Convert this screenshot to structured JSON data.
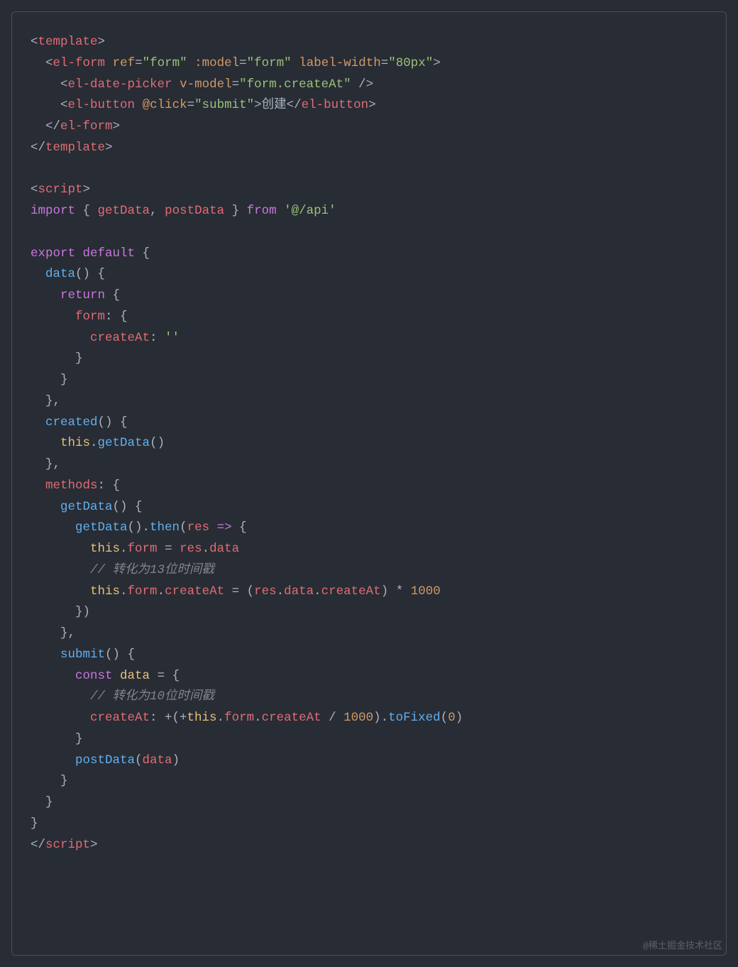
{
  "code": {
    "lines": [
      {
        "tokens": [
          {
            "t": "<",
            "c": "angle"
          },
          {
            "t": "template",
            "c": "tag"
          },
          {
            "t": ">",
            "c": "angle"
          }
        ]
      },
      {
        "tokens": [
          {
            "t": "  ",
            "c": "punct"
          },
          {
            "t": "<",
            "c": "angle"
          },
          {
            "t": "el-form",
            "c": "tag"
          },
          {
            "t": " ",
            "c": "punct"
          },
          {
            "t": "ref",
            "c": "attr"
          },
          {
            "t": "=",
            "c": "punct"
          },
          {
            "t": "\"form\"",
            "c": "attrv"
          },
          {
            "t": " ",
            "c": "punct"
          },
          {
            "t": ":model",
            "c": "attr"
          },
          {
            "t": "=",
            "c": "punct"
          },
          {
            "t": "\"form\"",
            "c": "attrv"
          },
          {
            "t": " ",
            "c": "punct"
          },
          {
            "t": "label-width",
            "c": "attr"
          },
          {
            "t": "=",
            "c": "punct"
          },
          {
            "t": "\"80px\"",
            "c": "attrv"
          },
          {
            "t": ">",
            "c": "angle"
          }
        ]
      },
      {
        "tokens": [
          {
            "t": "    ",
            "c": "punct"
          },
          {
            "t": "<",
            "c": "angle"
          },
          {
            "t": "el-date-picker",
            "c": "tag"
          },
          {
            "t": " ",
            "c": "punct"
          },
          {
            "t": "v-model",
            "c": "attr"
          },
          {
            "t": "=",
            "c": "punct"
          },
          {
            "t": "\"form.createAt\"",
            "c": "attrv"
          },
          {
            "t": " />",
            "c": "angle"
          }
        ]
      },
      {
        "tokens": [
          {
            "t": "    ",
            "c": "punct"
          },
          {
            "t": "<",
            "c": "angle"
          },
          {
            "t": "el-button",
            "c": "tag"
          },
          {
            "t": " ",
            "c": "punct"
          },
          {
            "t": "@click",
            "c": "attr"
          },
          {
            "t": "=",
            "c": "punct"
          },
          {
            "t": "\"submit\"",
            "c": "attrv"
          },
          {
            "t": ">",
            "c": "angle"
          },
          {
            "t": "创建",
            "c": "text"
          },
          {
            "t": "</",
            "c": "angle"
          },
          {
            "t": "el-button",
            "c": "tag"
          },
          {
            "t": ">",
            "c": "angle"
          }
        ]
      },
      {
        "tokens": [
          {
            "t": "  ",
            "c": "punct"
          },
          {
            "t": "</",
            "c": "angle"
          },
          {
            "t": "el-form",
            "c": "tag"
          },
          {
            "t": ">",
            "c": "angle"
          }
        ]
      },
      {
        "tokens": [
          {
            "t": "</",
            "c": "angle"
          },
          {
            "t": "template",
            "c": "tag"
          },
          {
            "t": ">",
            "c": "angle"
          }
        ]
      },
      {
        "tokens": [
          {
            "t": "",
            "c": "punct"
          }
        ]
      },
      {
        "tokens": [
          {
            "t": "<",
            "c": "angle"
          },
          {
            "t": "script",
            "c": "tag"
          },
          {
            "t": ">",
            "c": "angle"
          }
        ]
      },
      {
        "tokens": [
          {
            "t": "import",
            "c": "kw"
          },
          {
            "t": " { ",
            "c": "punct"
          },
          {
            "t": "getData",
            "c": "ident"
          },
          {
            "t": ", ",
            "c": "punct"
          },
          {
            "t": "postData",
            "c": "ident"
          },
          {
            "t": " } ",
            "c": "punct"
          },
          {
            "t": "from",
            "c": "kw"
          },
          {
            "t": " ",
            "c": "punct"
          },
          {
            "t": "'@/api'",
            "c": "string"
          }
        ]
      },
      {
        "tokens": [
          {
            "t": "",
            "c": "punct"
          }
        ]
      },
      {
        "tokens": [
          {
            "t": "export",
            "c": "kw"
          },
          {
            "t": " ",
            "c": "punct"
          },
          {
            "t": "default",
            "c": "kw"
          },
          {
            "t": " {",
            "c": "punct"
          }
        ]
      },
      {
        "tokens": [
          {
            "t": "  ",
            "c": "punct"
          },
          {
            "t": "data",
            "c": "fn"
          },
          {
            "t": "() {",
            "c": "punct"
          }
        ]
      },
      {
        "tokens": [
          {
            "t": "    ",
            "c": "punct"
          },
          {
            "t": "return",
            "c": "kw"
          },
          {
            "t": " {",
            "c": "punct"
          }
        ]
      },
      {
        "tokens": [
          {
            "t": "      ",
            "c": "punct"
          },
          {
            "t": "form",
            "c": "ident"
          },
          {
            "t": ": {",
            "c": "punct"
          }
        ]
      },
      {
        "tokens": [
          {
            "t": "        ",
            "c": "punct"
          },
          {
            "t": "createAt",
            "c": "ident"
          },
          {
            "t": ": ",
            "c": "punct"
          },
          {
            "t": "''",
            "c": "string"
          }
        ]
      },
      {
        "tokens": [
          {
            "t": "      }",
            "c": "punct"
          }
        ]
      },
      {
        "tokens": [
          {
            "t": "    }",
            "c": "punct"
          }
        ]
      },
      {
        "tokens": [
          {
            "t": "  },",
            "c": "punct"
          }
        ]
      },
      {
        "tokens": [
          {
            "t": "  ",
            "c": "punct"
          },
          {
            "t": "created",
            "c": "fn"
          },
          {
            "t": "() {",
            "c": "punct"
          }
        ]
      },
      {
        "tokens": [
          {
            "t": "    ",
            "c": "punct"
          },
          {
            "t": "this",
            "c": "this"
          },
          {
            "t": ".",
            "c": "punct"
          },
          {
            "t": "getData",
            "c": "fn"
          },
          {
            "t": "()",
            "c": "punct"
          }
        ]
      },
      {
        "tokens": [
          {
            "t": "  },",
            "c": "punct"
          }
        ]
      },
      {
        "tokens": [
          {
            "t": "  ",
            "c": "punct"
          },
          {
            "t": "methods",
            "c": "ident"
          },
          {
            "t": ": {",
            "c": "punct"
          }
        ]
      },
      {
        "tokens": [
          {
            "t": "    ",
            "c": "punct"
          },
          {
            "t": "getData",
            "c": "fn"
          },
          {
            "t": "() {",
            "c": "punct"
          }
        ]
      },
      {
        "tokens": [
          {
            "t": "      ",
            "c": "punct"
          },
          {
            "t": "getData",
            "c": "fn"
          },
          {
            "t": "().",
            "c": "punct"
          },
          {
            "t": "then",
            "c": "fn"
          },
          {
            "t": "(",
            "c": "punct"
          },
          {
            "t": "res",
            "c": "ident"
          },
          {
            "t": " ",
            "c": "punct"
          },
          {
            "t": "=>",
            "c": "kw"
          },
          {
            "t": " {",
            "c": "punct"
          }
        ]
      },
      {
        "tokens": [
          {
            "t": "        ",
            "c": "punct"
          },
          {
            "t": "this",
            "c": "this"
          },
          {
            "t": ".",
            "c": "punct"
          },
          {
            "t": "form",
            "c": "prop2"
          },
          {
            "t": " = ",
            "c": "punct"
          },
          {
            "t": "res",
            "c": "ident"
          },
          {
            "t": ".",
            "c": "punct"
          },
          {
            "t": "data",
            "c": "prop2"
          }
        ]
      },
      {
        "tokens": [
          {
            "t": "        ",
            "c": "punct"
          },
          {
            "t": "// 转化为13位时间戳",
            "c": "comment"
          }
        ]
      },
      {
        "tokens": [
          {
            "t": "        ",
            "c": "punct"
          },
          {
            "t": "this",
            "c": "this"
          },
          {
            "t": ".",
            "c": "punct"
          },
          {
            "t": "form",
            "c": "prop2"
          },
          {
            "t": ".",
            "c": "punct"
          },
          {
            "t": "createAt",
            "c": "prop2"
          },
          {
            "t": " = (",
            "c": "punct"
          },
          {
            "t": "res",
            "c": "ident"
          },
          {
            "t": ".",
            "c": "punct"
          },
          {
            "t": "data",
            "c": "prop2"
          },
          {
            "t": ".",
            "c": "punct"
          },
          {
            "t": "createAt",
            "c": "prop2"
          },
          {
            "t": ") * ",
            "c": "punct"
          },
          {
            "t": "1000",
            "c": "num"
          }
        ]
      },
      {
        "tokens": [
          {
            "t": "      })",
            "c": "punct"
          }
        ]
      },
      {
        "tokens": [
          {
            "t": "    },",
            "c": "punct"
          }
        ]
      },
      {
        "tokens": [
          {
            "t": "    ",
            "c": "punct"
          },
          {
            "t": "submit",
            "c": "fn"
          },
          {
            "t": "() {",
            "c": "punct"
          }
        ]
      },
      {
        "tokens": [
          {
            "t": "      ",
            "c": "punct"
          },
          {
            "t": "const",
            "c": "kw"
          },
          {
            "t": " ",
            "c": "punct"
          },
          {
            "t": "data",
            "c": "this"
          },
          {
            "t": " = {",
            "c": "punct"
          }
        ]
      },
      {
        "tokens": [
          {
            "t": "        ",
            "c": "punct"
          },
          {
            "t": "// 转化为10位时间戳",
            "c": "comment"
          }
        ]
      },
      {
        "tokens": [
          {
            "t": "        ",
            "c": "punct"
          },
          {
            "t": "createAt",
            "c": "ident"
          },
          {
            "t": ": +(+",
            "c": "punct"
          },
          {
            "t": "this",
            "c": "this"
          },
          {
            "t": ".",
            "c": "punct"
          },
          {
            "t": "form",
            "c": "prop2"
          },
          {
            "t": ".",
            "c": "punct"
          },
          {
            "t": "createAt",
            "c": "prop2"
          },
          {
            "t": " / ",
            "c": "punct"
          },
          {
            "t": "1000",
            "c": "num"
          },
          {
            "t": ").",
            "c": "punct"
          },
          {
            "t": "toFixed",
            "c": "fn"
          },
          {
            "t": "(",
            "c": "punct"
          },
          {
            "t": "0",
            "c": "num"
          },
          {
            "t": ")",
            "c": "punct"
          }
        ]
      },
      {
        "tokens": [
          {
            "t": "      }",
            "c": "punct"
          }
        ]
      },
      {
        "tokens": [
          {
            "t": "      ",
            "c": "punct"
          },
          {
            "t": "postData",
            "c": "fn"
          },
          {
            "t": "(",
            "c": "punct"
          },
          {
            "t": "data",
            "c": "ident"
          },
          {
            "t": ")",
            "c": "punct"
          }
        ]
      },
      {
        "tokens": [
          {
            "t": "    }",
            "c": "punct"
          }
        ]
      },
      {
        "tokens": [
          {
            "t": "  }",
            "c": "punct"
          }
        ]
      },
      {
        "tokens": [
          {
            "t": "}",
            "c": "punct"
          }
        ]
      },
      {
        "tokens": [
          {
            "t": "</",
            "c": "angle"
          },
          {
            "t": "script",
            "c": "tag"
          },
          {
            "t": ">",
            "c": "angle"
          }
        ]
      }
    ]
  },
  "watermark": "@稀土掘金技术社区"
}
